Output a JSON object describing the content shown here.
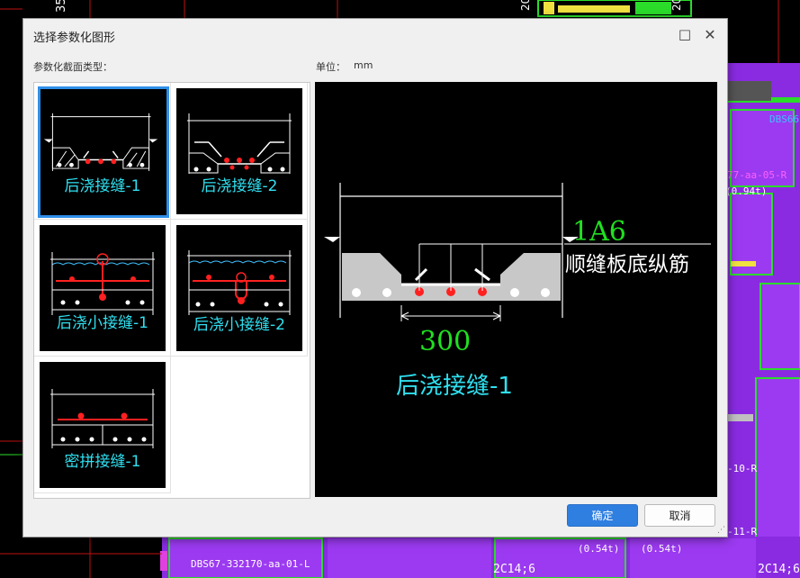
{
  "background": {
    "cad_labels": [
      "DBS66-",
      "DBS67-332170-aa-01-L",
      "2C14;6",
      "2C14;6",
      "(0.54t)",
      "(0.54t)",
      "(0.94t)",
      "77-aa-05-R",
      "-10-R",
      "-11-R",
      "35",
      "20",
      "20"
    ]
  },
  "dialog": {
    "title": "选择参数化图形",
    "type_label": "参数化截面类型：",
    "unit_label": "单位：",
    "unit_value": "mm",
    "ok_label": "确定",
    "cancel_label": "取消"
  },
  "shapes": [
    {
      "name": "后浇接缝-1",
      "selected": true
    },
    {
      "name": "后浇接缝-2",
      "selected": false
    },
    {
      "name": "后浇小接缝-1",
      "selected": false
    },
    {
      "name": "后浇小接缝-2",
      "selected": false
    },
    {
      "name": "密拼接缝-1",
      "selected": false
    }
  ],
  "preview": {
    "title": "后浇接缝-1",
    "rebar_spec": "1A6",
    "rebar_desc": "顺缝板底纵筋",
    "dimension": "300"
  },
  "colors": {
    "caption": "#2fe0f0",
    "rebar_red": "#ff2020",
    "dim_green": "#20e020",
    "cad_purple": "#8a2be2",
    "accent": "#2f7fe0"
  },
  "icons": {
    "maximize": "□",
    "close": "✕",
    "grip": "⋰"
  }
}
